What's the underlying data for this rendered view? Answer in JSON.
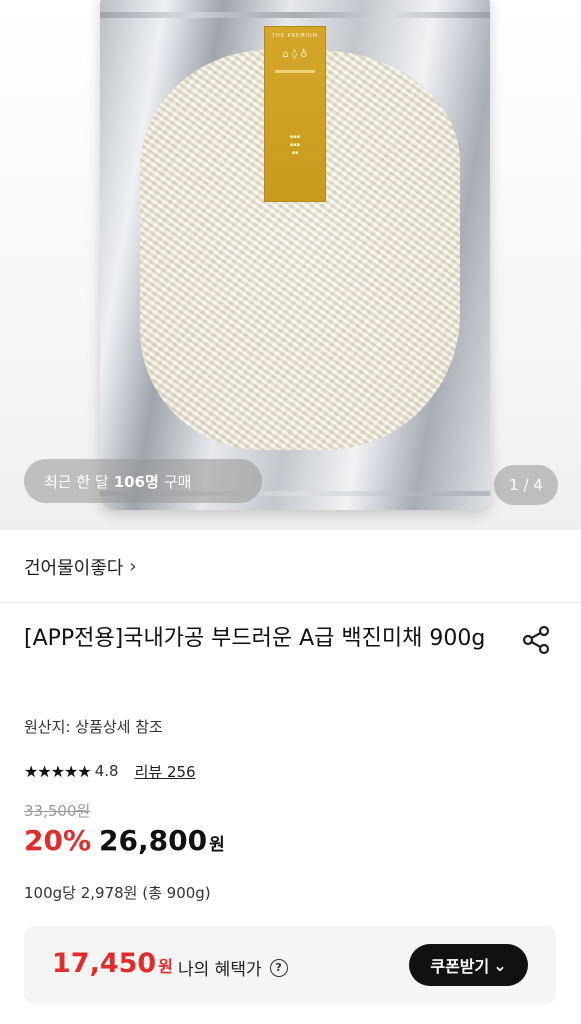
{
  "gallery": {
    "buyers_prefix": "최근 한 달",
    "buyers_count": "106명",
    "buyers_suffix": "구매",
    "page_indicator": "1 / 4"
  },
  "store": {
    "name": "건어물이좋다",
    "chevron": "›"
  },
  "product": {
    "title": "[APP전용]국내가공 부드러운 A급 백진미채 900g",
    "origin": "원산지: 상품상세 참조",
    "rating": "4.8",
    "stars": "★★★★★",
    "review_label": "리뷰 256",
    "original_price": "33,500원",
    "discount": "20%",
    "price": "26,800",
    "price_unit": "원",
    "unit_price": "100g당 2,978원 (총 900g)"
  },
  "benefit": {
    "price": "17,450",
    "price_unit": "원",
    "label": "나의 혜택가",
    "help_icon": "?",
    "coupon_button": "쿠폰받기",
    "coupon_chevron": "⌄"
  },
  "icons": {
    "share": "share-icon",
    "help": "question-circle-icon",
    "star": "star-icon"
  },
  "colors": {
    "discount_red": "#e42b2b",
    "button_black": "#111111",
    "label_gold": "#d4a72a"
  }
}
